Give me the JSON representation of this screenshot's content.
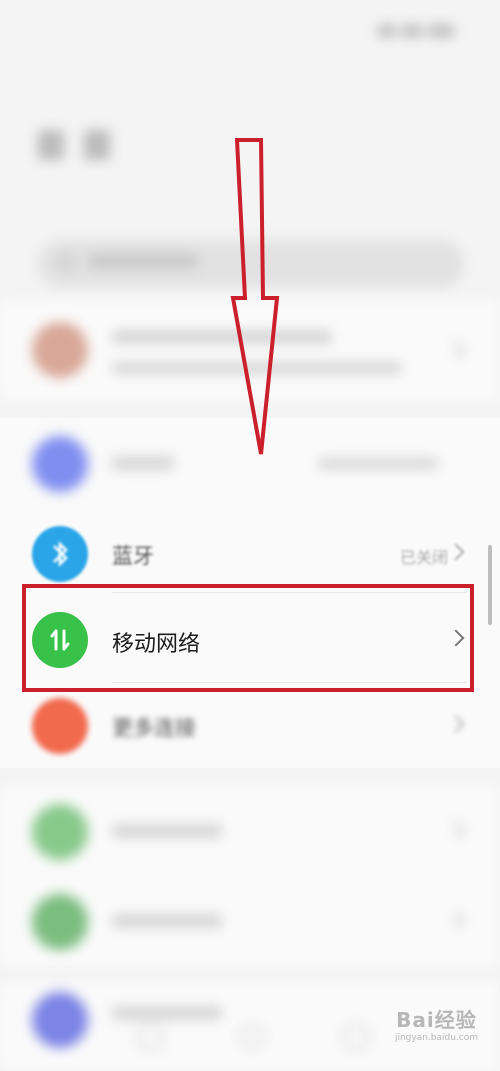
{
  "settings": {
    "rows": {
      "bluetooth": {
        "label": "蓝牙",
        "value": "已关闭"
      },
      "mobile_network": {
        "label": "移动网络"
      },
      "other_connections": {
        "label": "更多连接"
      }
    }
  },
  "watermark": {
    "text": "Bai经验",
    "sub": "jingyan.baidu.com"
  },
  "colors": {
    "mobile_icon": "#39c24a",
    "bluetooth_icon": "#2aa6e8",
    "annotation": "#cc1f2c"
  }
}
